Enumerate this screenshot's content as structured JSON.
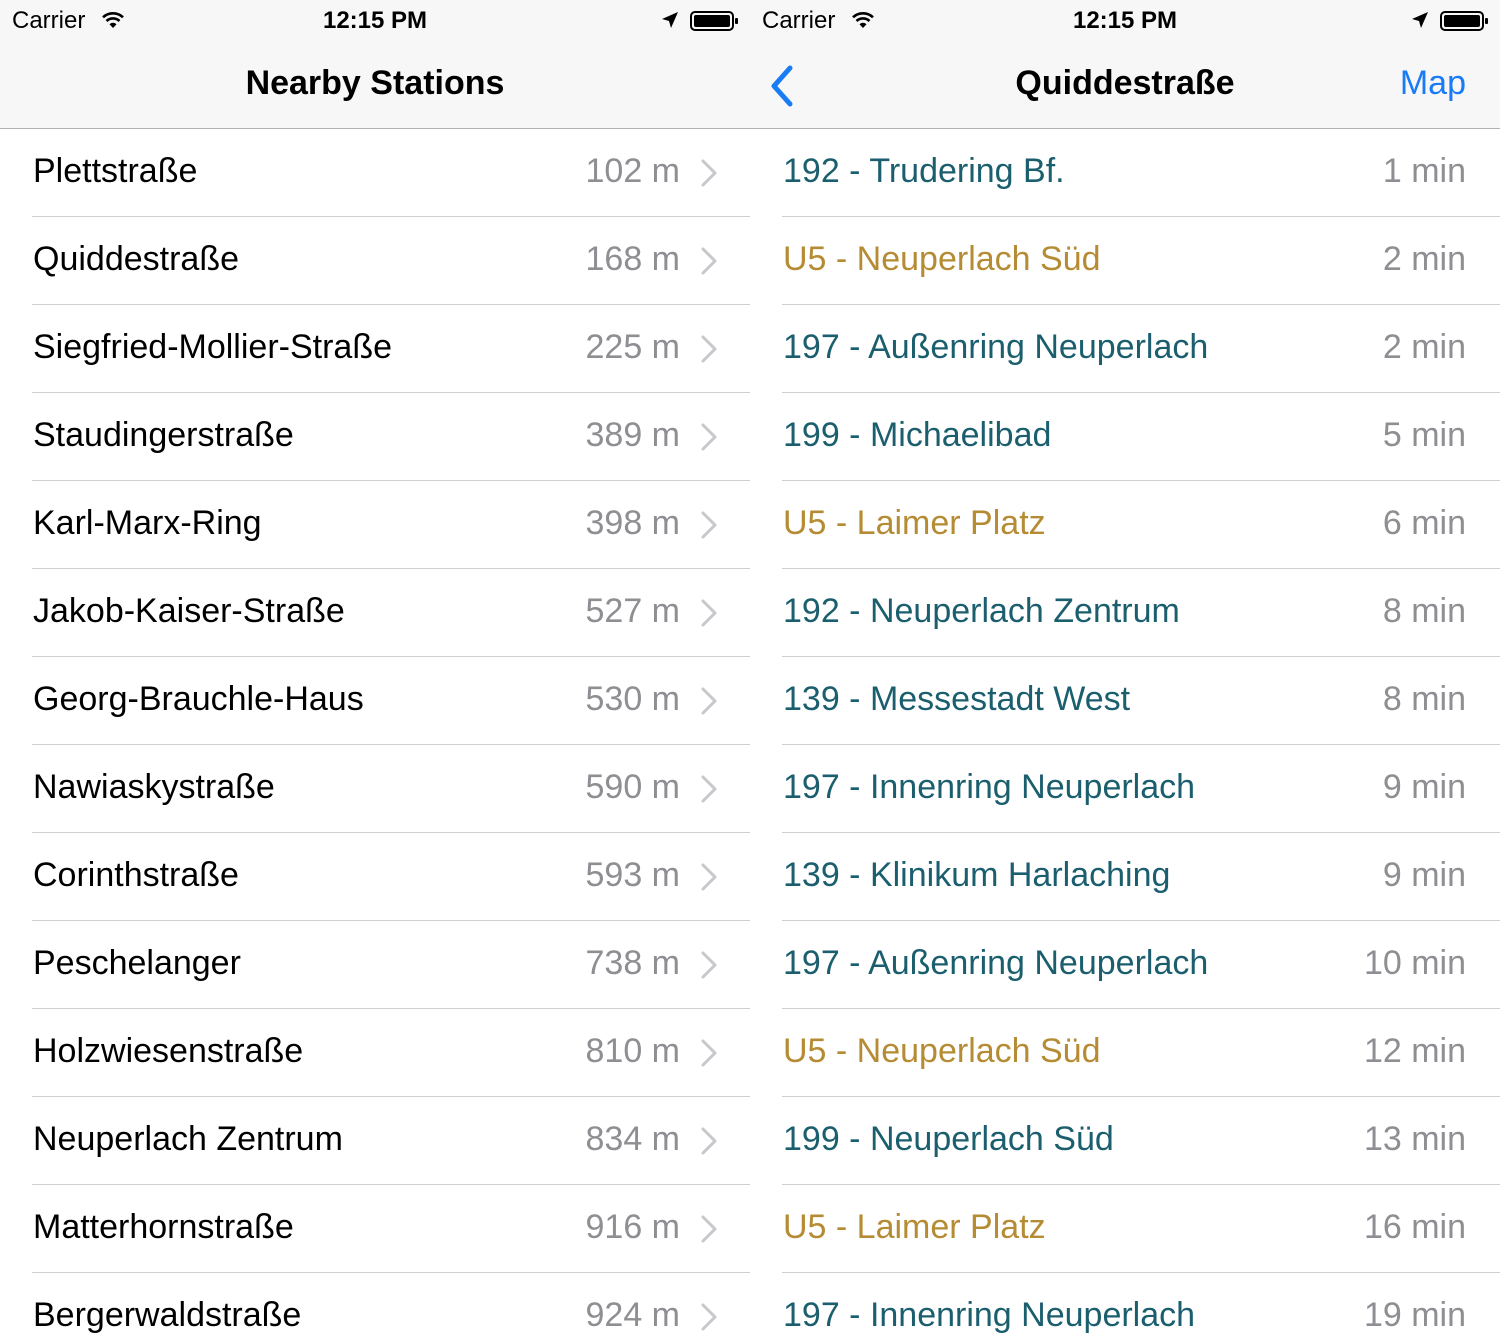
{
  "left": {
    "status": {
      "carrier": "Carrier",
      "time": "12:15 PM"
    },
    "title": "Nearby Stations",
    "stations": [
      {
        "name": "Plettstraße",
        "distance": "102 m"
      },
      {
        "name": "Quiddestraße",
        "distance": "168 m"
      },
      {
        "name": "Siegfried-Mollier-Straße",
        "distance": "225 m"
      },
      {
        "name": "Staudingerstraße",
        "distance": "389 m"
      },
      {
        "name": "Karl-Marx-Ring",
        "distance": "398 m"
      },
      {
        "name": "Jakob-Kaiser-Straße",
        "distance": "527 m"
      },
      {
        "name": "Georg-Brauchle-Haus",
        "distance": "530 m"
      },
      {
        "name": "Nawiaskystraße",
        "distance": "590 m"
      },
      {
        "name": "Corinthstraße",
        "distance": "593 m"
      },
      {
        "name": "Peschelanger",
        "distance": "738 m"
      },
      {
        "name": "Holzwiesenstraße",
        "distance": "810 m"
      },
      {
        "name": "Neuperlach Zentrum",
        "distance": "834 m"
      },
      {
        "name": "Matterhornstraße",
        "distance": "916 m"
      },
      {
        "name": "Bergerwaldstraße",
        "distance": "924 m"
      }
    ]
  },
  "right": {
    "status": {
      "carrier": "Carrier",
      "time": "12:15 PM"
    },
    "title": "Quiddestraße",
    "map_label": "Map",
    "departures": [
      {
        "line": "192 - Trudering Bf.",
        "time": "1 min",
        "type": "bus"
      },
      {
        "line": "U5 - Neuperlach Süd",
        "time": "2 min",
        "type": "ubahn"
      },
      {
        "line": "197 - Außenring Neuperlach",
        "time": "2 min",
        "type": "bus"
      },
      {
        "line": "199 - Michaelibad",
        "time": "5 min",
        "type": "bus"
      },
      {
        "line": "U5 - Laimer Platz",
        "time": "6 min",
        "type": "ubahn"
      },
      {
        "line": "192 - Neuperlach Zentrum",
        "time": "8 min",
        "type": "bus"
      },
      {
        "line": "139 - Messestadt West",
        "time": "8 min",
        "type": "bus"
      },
      {
        "line": "197 - Innenring Neuperlach",
        "time": "9 min",
        "type": "bus"
      },
      {
        "line": "139 - Klinikum Harlaching",
        "time": "9 min",
        "type": "bus"
      },
      {
        "line": "197 - Außenring Neuperlach",
        "time": "10 min",
        "type": "bus"
      },
      {
        "line": "U5 - Neuperlach Süd",
        "time": "12 min",
        "type": "ubahn"
      },
      {
        "line": "199 - Neuperlach Süd",
        "time": "13 min",
        "type": "bus"
      },
      {
        "line": "U5 - Laimer Platz",
        "time": "16 min",
        "type": "ubahn"
      },
      {
        "line": "197 - Innenring Neuperlach",
        "time": "19 min",
        "type": "bus"
      }
    ]
  },
  "colors": {
    "bus": "#1b5e6e",
    "ubahn": "#b58b33",
    "tint": "#1a7cf5",
    "secondary": "#8e8e93"
  },
  "icons": [
    "wifi-icon",
    "location-arrow-icon",
    "battery-icon",
    "back-chevron-icon",
    "chevron-right-icon"
  ]
}
